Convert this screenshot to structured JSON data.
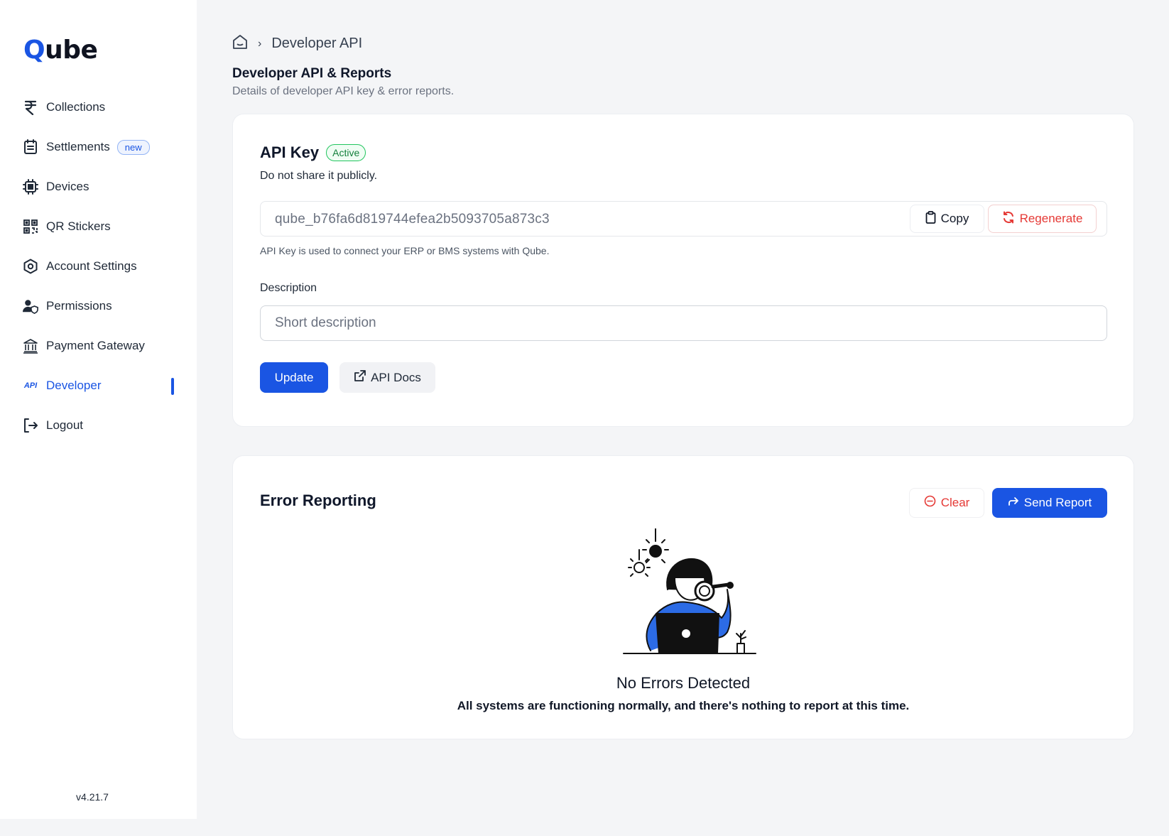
{
  "brand": {
    "logo_first": "Q",
    "logo_rest": "ube"
  },
  "sidebar": {
    "items": [
      {
        "label": "Collections",
        "icon": "rupee-icon"
      },
      {
        "label": "Settlements",
        "icon": "calendar-list-icon",
        "badge": "new"
      },
      {
        "label": "Devices",
        "icon": "chip-icon"
      },
      {
        "label": "QR Stickers",
        "icon": "qr-code-icon"
      },
      {
        "label": "Account Settings",
        "icon": "hexagon-settings-icon"
      },
      {
        "label": "Permissions",
        "icon": "user-shield-icon"
      },
      {
        "label": "Payment Gateway",
        "icon": "bank-icon"
      },
      {
        "label": "Developer",
        "icon": "api-icon",
        "icon_text": "API",
        "active": true
      },
      {
        "label": "Logout",
        "icon": "logout-icon"
      }
    ],
    "version": "v4.21.7"
  },
  "breadcrumb": {
    "separator": "›",
    "current": "Developer API"
  },
  "header": {
    "title": "Developer API & Reports",
    "subtitle": "Details of developer API key & error reports."
  },
  "api_key": {
    "title": "API Key",
    "status": "Active",
    "note": "Do not share it publicly.",
    "value": "qube_b76fa6d819744efea2b5093705a873c3",
    "copy_label": "Copy",
    "regenerate_label": "Regenerate",
    "hint": "API Key is used to connect your ERP or BMS systems with Qube.",
    "description_label": "Description",
    "description_placeholder": "Short description",
    "description_value": "",
    "update_label": "Update",
    "docs_label": "API Docs"
  },
  "error_reporting": {
    "title": "Error Reporting",
    "clear_label": "Clear",
    "send_label": "Send Report",
    "empty_title": "No Errors Detected",
    "empty_subtitle": "All systems are functioning normally, and there's nothing to report at this time."
  },
  "colors": {
    "accent": "#1a55e3",
    "danger": "#e53935",
    "success": "#15803d",
    "background": "#f4f5f7"
  }
}
